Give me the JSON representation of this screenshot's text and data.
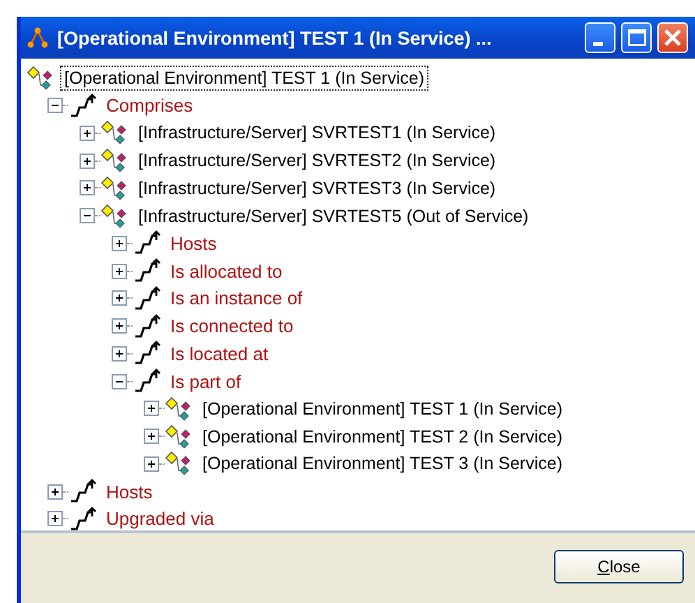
{
  "window": {
    "title": "[Operational Environment] TEST 1 (In Service) ..."
  },
  "tree": [
    {
      "kind": "object",
      "label": "[Operational Environment] TEST 1 (In Service)",
      "selected": true,
      "children": [
        {
          "kind": "relation",
          "label": "Comprises",
          "selected": false,
          "expanded": true,
          "children": [
            {
              "kind": "object",
              "label": "[Infrastructure/Server] SVRTEST1 (In Service)",
              "selected": false,
              "expanded": false
            },
            {
              "kind": "object",
              "label": "[Infrastructure/Server] SVRTEST2 (In Service)",
              "selected": false,
              "expanded": false
            },
            {
              "kind": "object",
              "label": "[Infrastructure/Server] SVRTEST3 (In Service)",
              "selected": false,
              "expanded": false
            },
            {
              "kind": "object",
              "label": "[Infrastructure/Server] SVRTEST5 (Out of Service)",
              "selected": false,
              "expanded": true,
              "children": [
                {
                  "kind": "relation",
                  "label": "Hosts",
                  "selected": false,
                  "expanded": false
                },
                {
                  "kind": "relation",
                  "label": "Is allocated to",
                  "selected": false,
                  "expanded": false
                },
                {
                  "kind": "relation",
                  "label": "Is an instance of",
                  "selected": false,
                  "expanded": false
                },
                {
                  "kind": "relation",
                  "label": "Is connected to",
                  "selected": false,
                  "expanded": false
                },
                {
                  "kind": "relation",
                  "label": "Is located at",
                  "selected": false,
                  "expanded": false
                },
                {
                  "kind": "relation",
                  "label": "Is part of",
                  "selected": false,
                  "expanded": true,
                  "children": [
                    {
                      "kind": "object",
                      "label": "[Operational Environment] TEST 1 (In Service)",
                      "selected": false,
                      "expanded": false
                    },
                    {
                      "kind": "object",
                      "label": "[Operational Environment] TEST 2 (In Service)",
                      "selected": false,
                      "expanded": false
                    },
                    {
                      "kind": "object",
                      "label": "[Operational Environment] TEST 3 (In Service)",
                      "selected": false,
                      "expanded": false
                    }
                  ]
                }
              ]
            }
          ]
        },
        {
          "kind": "relation",
          "label": "Hosts",
          "selected": false,
          "expanded": false
        },
        {
          "kind": "relation",
          "label": "Upgraded via",
          "selected": false,
          "expanded": false
        }
      ]
    }
  ],
  "buttons": [
    {
      "label": "Close"
    }
  ]
}
